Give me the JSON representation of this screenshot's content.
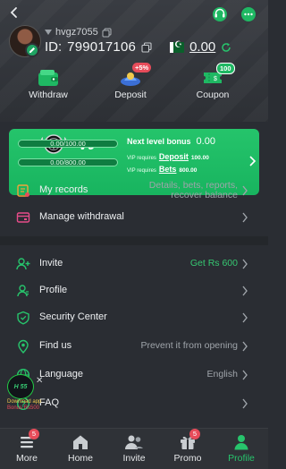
{
  "colors": {
    "accent": "#1fb863",
    "background": "#2a2d33",
    "red_badge": "#e74c5a",
    "green_text": "#36c771"
  },
  "header": {
    "username": "hvgz7055",
    "id_prefix": "ID:",
    "user_id": "799017106",
    "balance": "0.00",
    "icons": [
      "back-icon",
      "support-icon",
      "chat-icon",
      "copy-icon",
      "flag-icon",
      "refresh-icon"
    ]
  },
  "quick_actions": [
    {
      "label": "Withdraw",
      "icon": "wallet-icon",
      "badge": ""
    },
    {
      "label": "Deposit",
      "icon": "deposit-icon",
      "badge": "+5%"
    },
    {
      "label": "Coupon",
      "icon": "coupon-icon",
      "badge": "100"
    }
  ],
  "vip": {
    "level": "V0",
    "progress_1": "0.00/100.00",
    "progress_1_fraction": 0,
    "progress_2": "0.00/800.00",
    "progress_2_fraction": 0,
    "next_level_label": "Next level bonus",
    "next_level_value": "0.00",
    "req_deposit_prefix": "VIP requires",
    "req_deposit_link": "Deposit",
    "req_deposit_amount": "100.00",
    "req_bets_prefix": "VIP requires",
    "req_bets_link": "Bets",
    "req_bets_amount": "800.00"
  },
  "records": [
    {
      "label": "My records",
      "value": "Details, bets, reports, recover balance",
      "icon": "records-icon"
    },
    {
      "label": "Manage withdrawal",
      "value": "",
      "icon": "withdrawal-manage-icon"
    }
  ],
  "menu": [
    {
      "label": "Invite",
      "value": "Get Rs 600",
      "icon": "invite-icon"
    },
    {
      "label": "Profile",
      "value": "",
      "icon": "profile-icon"
    },
    {
      "label": "Security Center",
      "value": "",
      "icon": "shield-icon"
    },
    {
      "label": "Find us",
      "value": "Prevent it from opening",
      "icon": "location-icon"
    },
    {
      "label": "Language",
      "value": "English",
      "icon": "globe-icon"
    },
    {
      "label": "FAQ",
      "value": "",
      "icon": "faq-icon"
    }
  ],
  "float_ad": {
    "logo_text": "H 55",
    "line1": "Download app",
    "line2": "Bonus Rs500"
  },
  "bottom_nav": [
    {
      "label": "More",
      "icon": "menu-icon",
      "badge": "5"
    },
    {
      "label": "Home",
      "icon": "home-icon",
      "badge": ""
    },
    {
      "label": "Invite",
      "icon": "invite-people-icon",
      "badge": ""
    },
    {
      "label": "Promo",
      "icon": "gift-icon",
      "badge": "5"
    },
    {
      "label": "Profile",
      "icon": "profile-nav-icon",
      "badge": "",
      "active": true
    }
  ]
}
